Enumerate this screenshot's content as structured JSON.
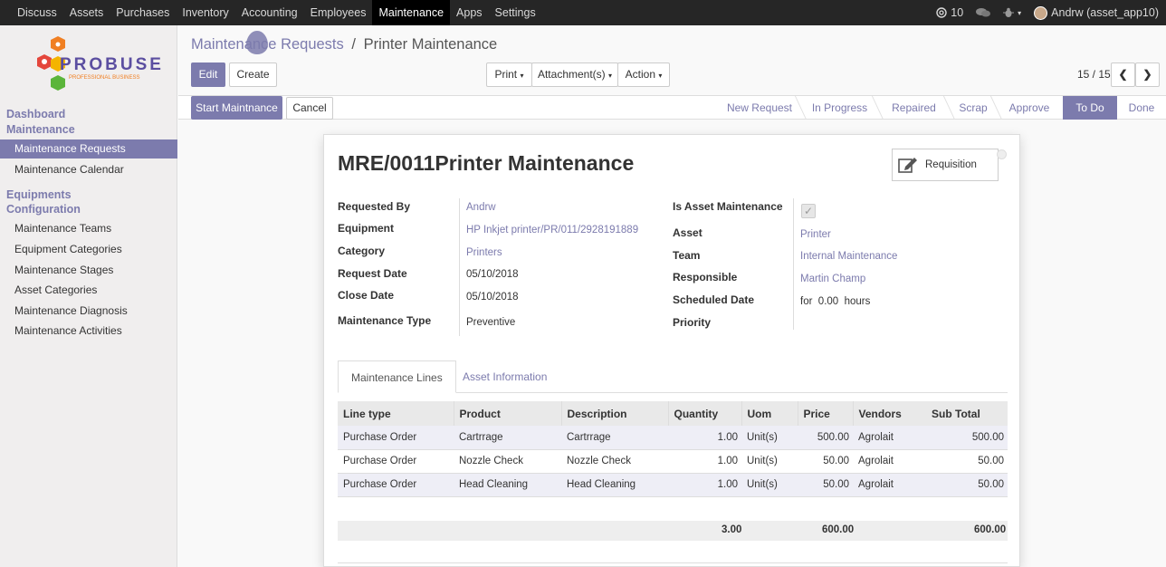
{
  "topbar": {
    "menu": [
      "Discuss",
      "Assets",
      "Purchases",
      "Inventory",
      "Accounting",
      "Employees",
      "Maintenance",
      "Apps",
      "Settings"
    ],
    "active": "Maintenance",
    "notifications": "10",
    "user": "Andrw (asset_app10)"
  },
  "logo": {
    "brand": "PROBUSE",
    "tagline": "PROFESSIONAL BUSINESS"
  },
  "sidebar": {
    "section1": "Dashboard",
    "section2": "Maintenance",
    "items_main": [
      "Maintenance Requests",
      "Maintenance Calendar"
    ],
    "section3": "Equipments",
    "section4": "Configuration",
    "items_config": [
      "Maintenance Teams",
      "Equipment Categories",
      "Maintenance Stages",
      "Asset Categories",
      "Maintenance Diagnosis",
      "Maintenance Activities"
    ]
  },
  "breadcrumb": {
    "parent": "Maintenance Requests",
    "separator": "/",
    "current": "Printer Maintenance"
  },
  "toolbar": {
    "edit": "Edit",
    "create": "Create",
    "print": "Print",
    "attachments": "Attachment(s)",
    "action": "Action",
    "pager": "15 / 15"
  },
  "actions": {
    "start": "Start Maintnance",
    "cancel": "Cancel"
  },
  "stages": [
    "New Request",
    "In Progress",
    "Repaired",
    "Scrap",
    "Approve",
    "To Do",
    "Done"
  ],
  "active_stage": "To Do",
  "form": {
    "title": "MRE/0011Printer Maintenance",
    "requisition": "Requisition",
    "left": [
      {
        "label": "Requested By",
        "value": "Andrw",
        "link": true
      },
      {
        "label": "Equipment",
        "value": "HP Inkjet printer/PR/011/2928191889",
        "link": true
      },
      {
        "label": "Category",
        "value": "Printers",
        "link": true
      },
      {
        "label": "Request Date",
        "value": "05/10/2018",
        "link": false
      },
      {
        "label": "Close Date",
        "value": "05/10/2018",
        "link": false
      },
      {
        "label": "Maintenance Type",
        "value": "Preventive",
        "link": false
      }
    ],
    "right": [
      {
        "label": "Is Asset Maintenance",
        "value": "",
        "link": false
      },
      {
        "label": "Asset",
        "value": "Printer",
        "link": true
      },
      {
        "label": "Team",
        "value": "Internal Maintenance",
        "link": true
      },
      {
        "label": "Responsible",
        "value": "Martin Champ",
        "link": true
      },
      {
        "label": "Scheduled Date",
        "value": "for  0.00  hours",
        "link": false
      },
      {
        "label": "Priority",
        "value": "",
        "link": false
      }
    ],
    "is_asset_checked": true
  },
  "tabs": [
    "Maintenance Lines",
    "Asset Information"
  ],
  "lines": {
    "headers": [
      "Line type",
      "Product",
      "Description",
      "Quantity",
      "Uom",
      "Price",
      "Vendors",
      "Sub Total"
    ],
    "rows": [
      [
        "Purchase Order",
        "Cartrrage",
        "Cartrrage",
        "1.00",
        "Unit(s)",
        "500.00",
        "Agrolait",
        "500.00"
      ],
      [
        "Purchase Order",
        "Nozzle Check",
        "Nozzle Check",
        "1.00",
        "Unit(s)",
        "50.00",
        "Agrolait",
        "50.00"
      ],
      [
        "Purchase Order",
        "Head Cleaning",
        "Head Cleaning",
        "1.00",
        "Unit(s)",
        "50.00",
        "Agrolait",
        "50.00"
      ]
    ],
    "totals": {
      "quantity": "3.00",
      "price": "600.00",
      "subtotal": "600.00"
    }
  },
  "colors": {
    "accent": "#7c7bad",
    "topbar": "#262626"
  }
}
